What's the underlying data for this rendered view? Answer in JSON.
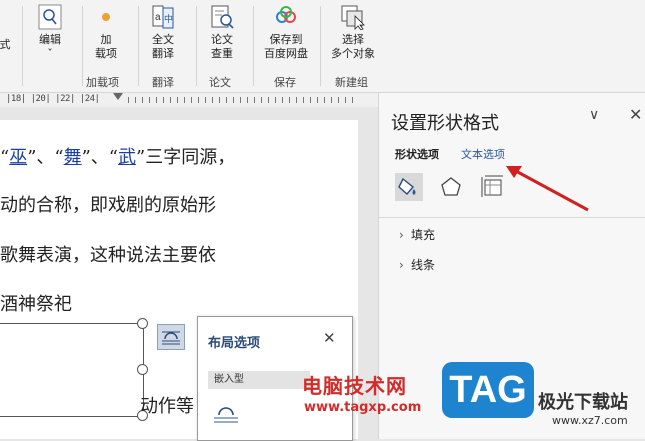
{
  "ribbon": {
    "left_cut_label": "式",
    "edit": {
      "label": "编辑",
      "dropdown": "ˇ"
    },
    "addins": {
      "label": "加\n载项",
      "group": "加载项"
    },
    "translate": {
      "label": "全文\n翻译",
      "group": "翻译"
    },
    "paper": {
      "label": "论文\n查重",
      "group": "论文"
    },
    "save_cloud": {
      "label": "保存到\n百度网盘",
      "group": "保存"
    },
    "select_objects": {
      "label": "选择\n多个对象",
      "group": "新建组"
    }
  },
  "ruler": {
    "text": "|18| |20| |22| |24|"
  },
  "document": {
    "line1_prefix": "“",
    "line1_w1": "巫",
    "line1_sep1": "”、“",
    "line1_w2": "舞",
    "line1_sep2": "”、“",
    "line1_w3": "武",
    "line1_suffix": "”三字同源，",
    "line2": "动的合称，即戏剧的原始形",
    "line3": "歌舞表演，这种说法主要依",
    "line4": "酒神祭祀",
    "line5": "动作等"
  },
  "layout_popup": {
    "title": "布局选项",
    "close": "✕",
    "section": "嵌入型"
  },
  "format_panel": {
    "title": "设置形状格式",
    "chevron": "∨",
    "close": "✕",
    "tab_shape": "形状选项",
    "tab_text": "文本选项",
    "rows": [
      {
        "label": "填充",
        "chev": "›"
      },
      {
        "label": "线条",
        "chev": "›"
      }
    ],
    "icons": [
      "fill-line-icon",
      "effects-icon",
      "size-properties-icon"
    ],
    "accent": "#2b5797",
    "arrow_color": "#d02020"
  },
  "watermark": {
    "cn": "电脑技术网",
    "url": "www.tagxp.com",
    "tag": "TAG",
    "side": "极光下载站",
    "side2": "www.xz7.com"
  }
}
